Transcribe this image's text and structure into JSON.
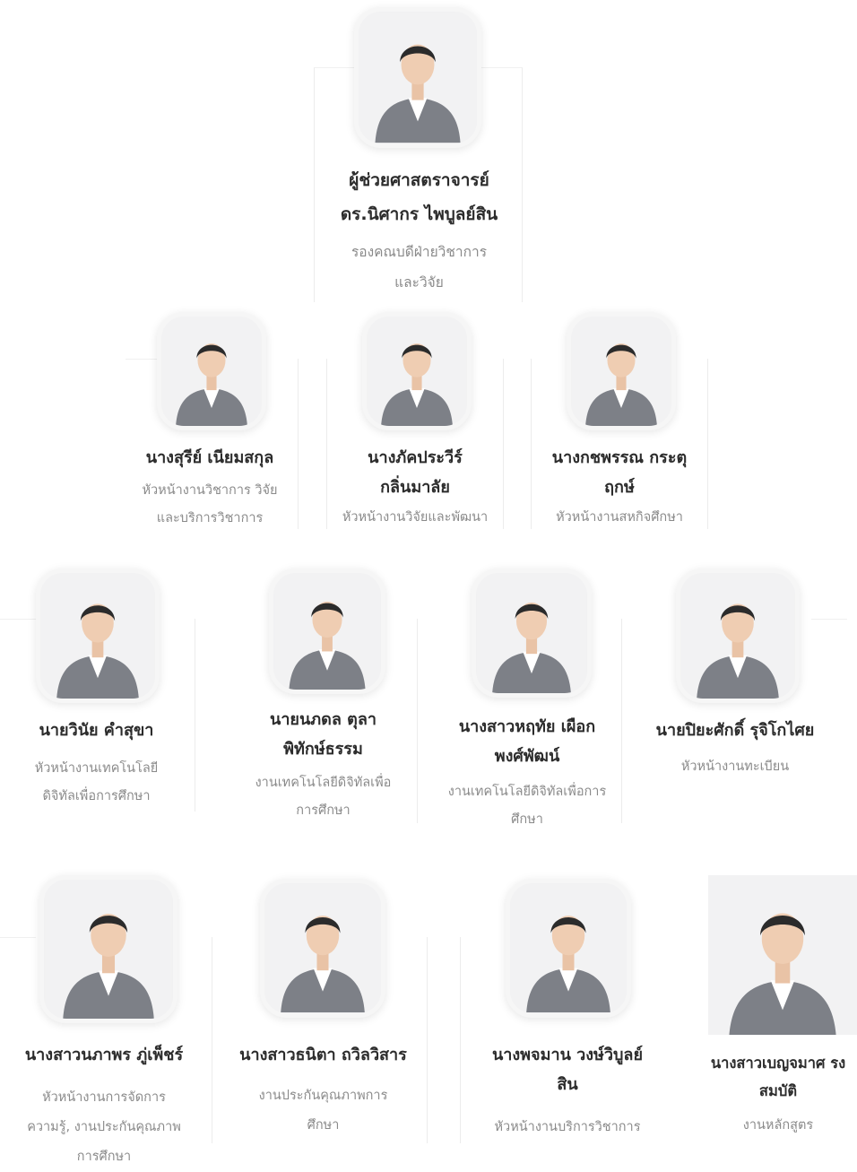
{
  "people": [
    {
      "id": "dean",
      "name": "ผู้ช่วยศาสตราจารย์ ดร.นิศากร ไพบูลย์สิน",
      "role": "รองคณบดีฝ่ายวิชาการ และวิจัย",
      "icon": "portrait-photo"
    },
    {
      "id": "p1",
      "name": "นางสุรีย์ เนียมสกุล",
      "role": "หัวหน้างานวิชาการ วิจัยและบริการวิชาการ",
      "icon": "portrait-photo"
    },
    {
      "id": "p2",
      "name": "นางภัคประวีร์ กลิ่นมาลัย",
      "role": "หัวหน้างานวิจัยและพัฒนา",
      "icon": "portrait-photo"
    },
    {
      "id": "p3",
      "name": "นางกชพรรณ กระตุฤกษ์",
      "role": "หัวหน้างานสหกิจศึกษา",
      "icon": "portrait-photo"
    },
    {
      "id": "p4",
      "name": "นายวินัย คำสุขา",
      "role": "หัวหน้างานเทคโนโลยีดิจิทัลเพื่อการศึกษา",
      "icon": "portrait-photo"
    },
    {
      "id": "p5",
      "name": "นายนภดล ตุลาพิทักษ์ธรรม",
      "role": "งานเทคโนโลยีดิจิทัลเพื่อการศึกษา",
      "icon": "portrait-photo"
    },
    {
      "id": "p6",
      "name": "นางสาวหฤทัย เผือกพงศ์พัฒน์",
      "role": "งานเทคโนโลยีดิจิทัลเพื่อการศึกษา",
      "icon": "portrait-photo"
    },
    {
      "id": "p7",
      "name": "นายปิยะศักดิ์ รุจิโกไศย",
      "role": "หัวหน้างานทะเบียน",
      "icon": "portrait-photo"
    },
    {
      "id": "p8",
      "name": "นางสาวนภาพร ภู่เพ็ชร์",
      "role": "หัวหน้างานการจัดการความรู้, งานประกันคุณภาพการศึกษา",
      "icon": "portrait-photo"
    },
    {
      "id": "p9",
      "name": "นางสาวธนิตา ถวิลวิสาร",
      "role": "งานประกันคุณภาพการศึกษา",
      "icon": "portrait-photo"
    },
    {
      "id": "p10",
      "name": "นางพจมาน วงษ์วิบูลย์สิน",
      "role": "หัวหน้างานบริการวิชาการ",
      "icon": "portrait-photo"
    },
    {
      "id": "p11",
      "name": "นางสาวเบญจมาศ รงสมบัติ",
      "role": "งานหลักสูตร",
      "icon": "portrait-photo"
    }
  ],
  "colors": {
    "name": "#2c2c2c",
    "role": "#8a8a8a",
    "suit": "#7d8087",
    "frame": "#f1f1f2"
  }
}
